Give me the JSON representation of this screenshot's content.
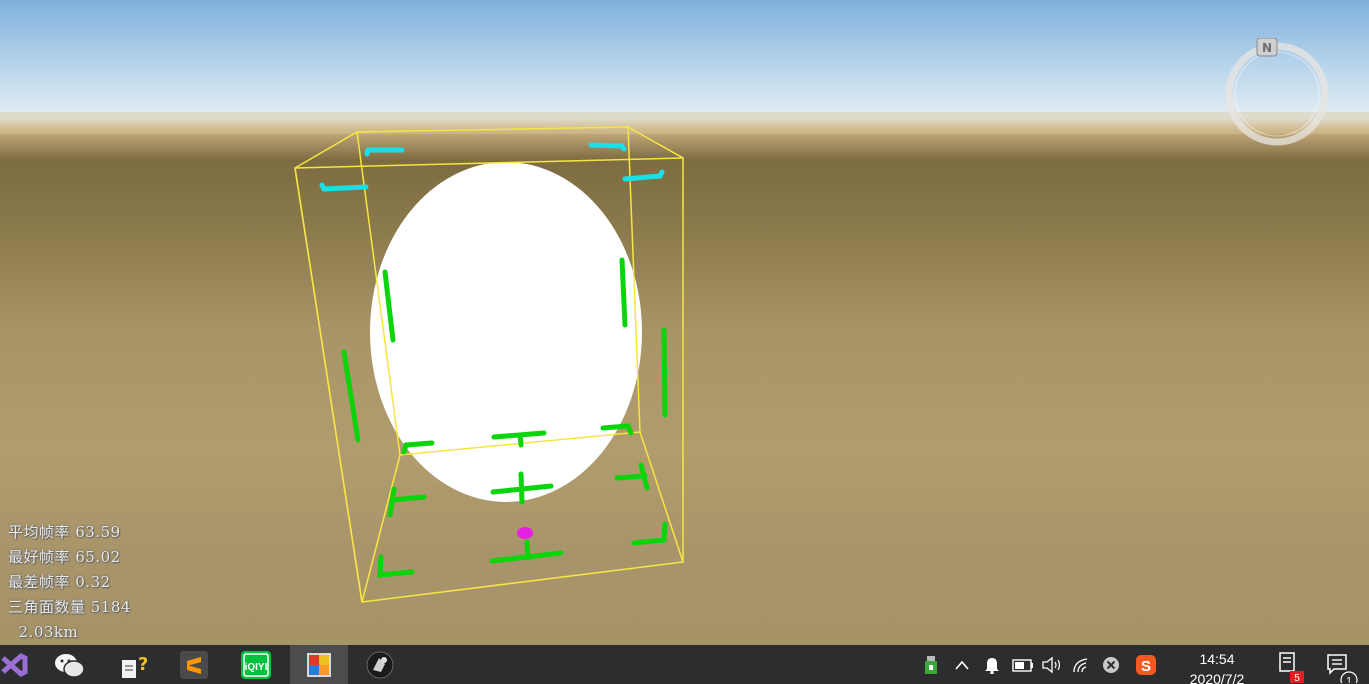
{
  "hud": {
    "avg_fps": "平均帧率 63.59",
    "best_fps": "最好帧率 65.02",
    "worst_fps": "最差帧率 0.32",
    "triangles": "三角面数量 5184",
    "distance": "  2.03km"
  },
  "compass": {
    "north_label": "N"
  },
  "taskbar": {
    "apps": [
      {
        "name": "visual-studio-icon"
      },
      {
        "name": "wechat-icon"
      },
      {
        "name": "help-document-icon"
      },
      {
        "name": "sublime-text-icon"
      },
      {
        "name": "iqiyi-icon",
        "label": "iQIYI"
      },
      {
        "name": "image-viewer-app-icon",
        "active": true
      },
      {
        "name": "media-player-app-icon"
      }
    ],
    "tray": {
      "notification_badge": "5",
      "notifications_count": "1",
      "ime_label": "S"
    },
    "clock": {
      "time": "14:54",
      "date": "2020/7/2"
    }
  },
  "colors": {
    "box_outline": "#f5e642",
    "blue_markers": "#19e0e6",
    "green_markers": "#0ad40a",
    "center_marker": "#e61ee6",
    "ellipse": "#ffffff"
  }
}
